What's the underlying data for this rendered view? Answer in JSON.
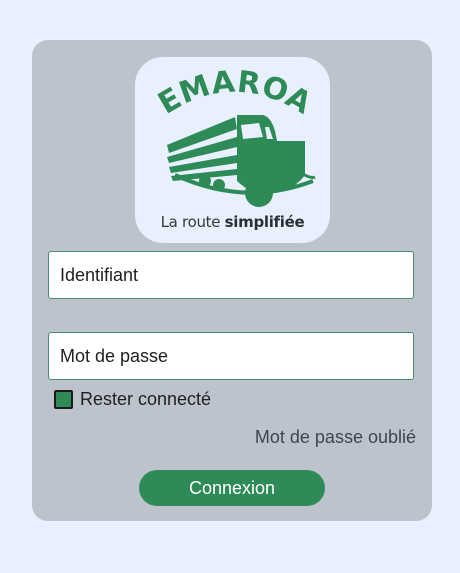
{
  "logo": {
    "brand": "DEMAROAD",
    "tagline_regular": "La route",
    "tagline_bold": "simplifiée"
  },
  "form": {
    "username_placeholder": "Identifiant",
    "password_placeholder": "Mot de passe",
    "remember_label": "Rester connecté",
    "remember_checked": true,
    "forgot_label": "Mot de passe oublié",
    "submit_label": "Connexion"
  },
  "colors": {
    "brand_green": "#2e8b57",
    "card_bg": "#bcc3cd",
    "page_bg": "#e9f0fd"
  }
}
